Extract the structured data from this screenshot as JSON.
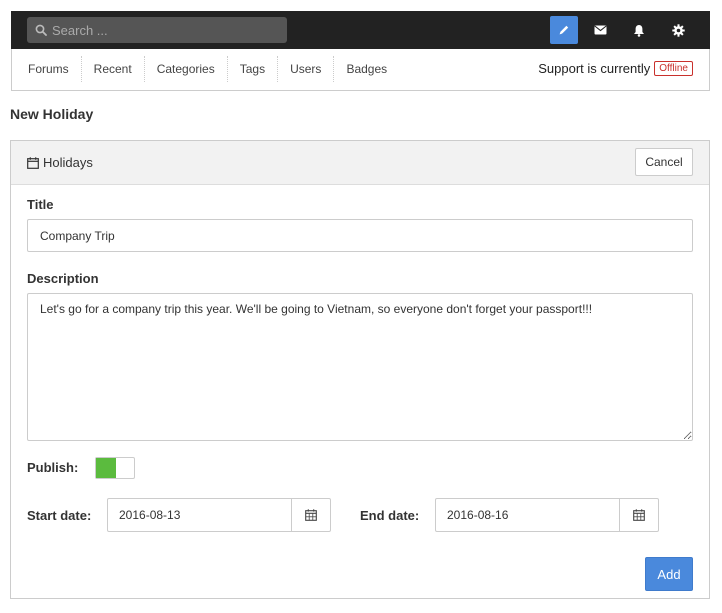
{
  "topbar": {
    "search_placeholder": "Search ...",
    "icons": [
      "pencil-icon",
      "envelope-icon",
      "bell-icon",
      "gear-icon"
    ],
    "active_color": "#4a89dc"
  },
  "nav": {
    "links": [
      "Forums",
      "Recent",
      "Categories",
      "Tags",
      "Users",
      "Badges"
    ],
    "support_label": "Support is currently",
    "support_status": "Offline",
    "status_color": "#c9302c"
  },
  "page": {
    "title": "New Holiday"
  },
  "panel": {
    "title": "Holidays",
    "cancel_label": "Cancel"
  },
  "form": {
    "title_label": "Title",
    "title_value": "Company Trip",
    "description_label": "Description",
    "description_value": "Let's go for a company trip this year. We'll be going to Vietnam, so everyone don't forget your passport!!!",
    "publish_label": "Publish:",
    "publish_on": true,
    "publish_color": "#5bbb3e",
    "start_label": "Start date:",
    "start_value": "2016-08-13",
    "end_label": "End date:",
    "end_value": "2016-08-16",
    "add_label": "Add"
  }
}
